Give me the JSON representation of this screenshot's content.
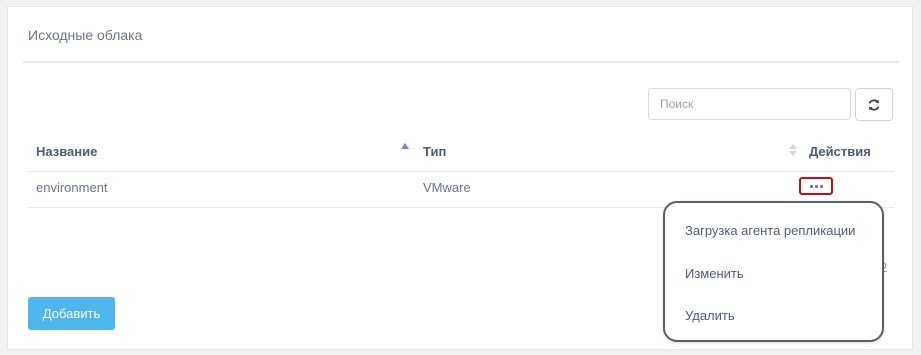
{
  "panel": {
    "title": "Исходные облака"
  },
  "search": {
    "placeholder": "Поиск",
    "value": ""
  },
  "refresh_icon": "refresh-icon",
  "table": {
    "columns": [
      "Название",
      "Тип",
      "Действия"
    ],
    "sort": {
      "column": "Название",
      "direction": "ascending"
    },
    "rows": [
      {
        "name": "environment",
        "type": "VMware"
      }
    ]
  },
  "actions_menu": {
    "items": [
      "Загрузка агента репликации",
      "Изменить",
      "Удалить"
    ]
  },
  "footer": {
    "add_label": "Добавить",
    "partial_text": "2"
  },
  "colors": {
    "accent": "#4fb6ec",
    "highlight": "#c0101a",
    "sort_active": "#7b86c9"
  }
}
